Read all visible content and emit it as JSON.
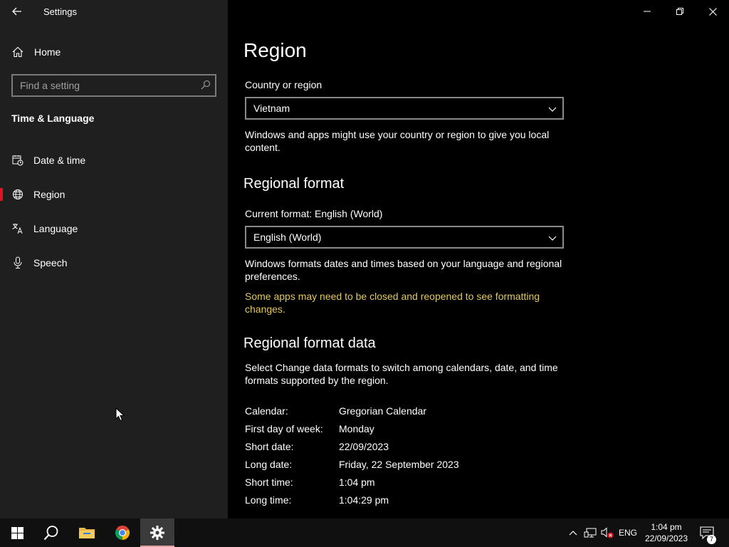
{
  "window": {
    "title": "Settings"
  },
  "sidebar": {
    "home_label": "Home",
    "search_placeholder": "Find a setting",
    "section_title": "Time & Language",
    "items": [
      {
        "label": "Date & time",
        "icon": "calendar-clock-icon",
        "selected": false
      },
      {
        "label": "Region",
        "icon": "globe-icon",
        "selected": true
      },
      {
        "label": "Language",
        "icon": "language-icon",
        "selected": false
      },
      {
        "label": "Speech",
        "icon": "microphone-icon",
        "selected": false
      }
    ]
  },
  "main": {
    "page_title": "Region",
    "country": {
      "label": "Country or region",
      "value": "Vietnam",
      "description": "Windows and apps might use your country or region to give you local content."
    },
    "regional_format": {
      "heading": "Regional format",
      "current_label": "Current format: English (World)",
      "value": "English (World)",
      "description": "Windows formats dates and times based on your language and regional preferences.",
      "warning": "Some apps may need to be closed and reopened to see formatting changes."
    },
    "format_data": {
      "heading": "Regional format data",
      "description": "Select Change data formats to switch among calendars, date, and time formats supported by the region.",
      "rows": [
        {
          "key": "Calendar:",
          "value": "Gregorian Calendar"
        },
        {
          "key": "First day of week:",
          "value": "Monday"
        },
        {
          "key": "Short date:",
          "value": "22/09/2023"
        },
        {
          "key": "Long date:",
          "value": "Friday, 22 September 2023"
        },
        {
          "key": "Short time:",
          "value": "1:04 pm"
        },
        {
          "key": "Long time:",
          "value": "1:04:29 pm"
        }
      ]
    }
  },
  "taskbar": {
    "pinned": [
      "start-icon",
      "search-icon",
      "file-explorer-icon",
      "chrome-icon",
      "settings-icon"
    ],
    "language": "ENG",
    "time": "1:04 pm",
    "date": "22/09/2023",
    "notification_count": "7"
  },
  "colors": {
    "sidebar_bg": "#1f1f1f",
    "accent_selected": "#e81123",
    "warning_text": "#e3c85e",
    "taskbar_bg": "#101010"
  }
}
